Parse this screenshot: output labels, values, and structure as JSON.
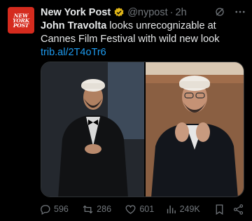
{
  "account": {
    "avatar_text": "NEW\nYORK\nPOST",
    "name": "New York Post",
    "handle": "@nypost",
    "separator": "·",
    "time": "2h"
  },
  "tweet": {
    "bold_text": "John Travolta",
    "text": " looks unrecognizable at Cannes Film Festival with wild new look",
    "link": "trib.al/2T4oTr6"
  },
  "media": {
    "images": [
      {
        "description_icon": "photo-icon"
      },
      {
        "description_icon": "photo-icon"
      }
    ]
  },
  "actions": {
    "replies": "596",
    "reposts": "286",
    "likes": "601",
    "views": "249K"
  },
  "colors": {
    "background": "#000000",
    "text": "#e7e9ea",
    "muted": "#71767b",
    "link": "#1d9bf0",
    "verified": "#e2b719",
    "avatar_bg": "#d52b1e"
  }
}
